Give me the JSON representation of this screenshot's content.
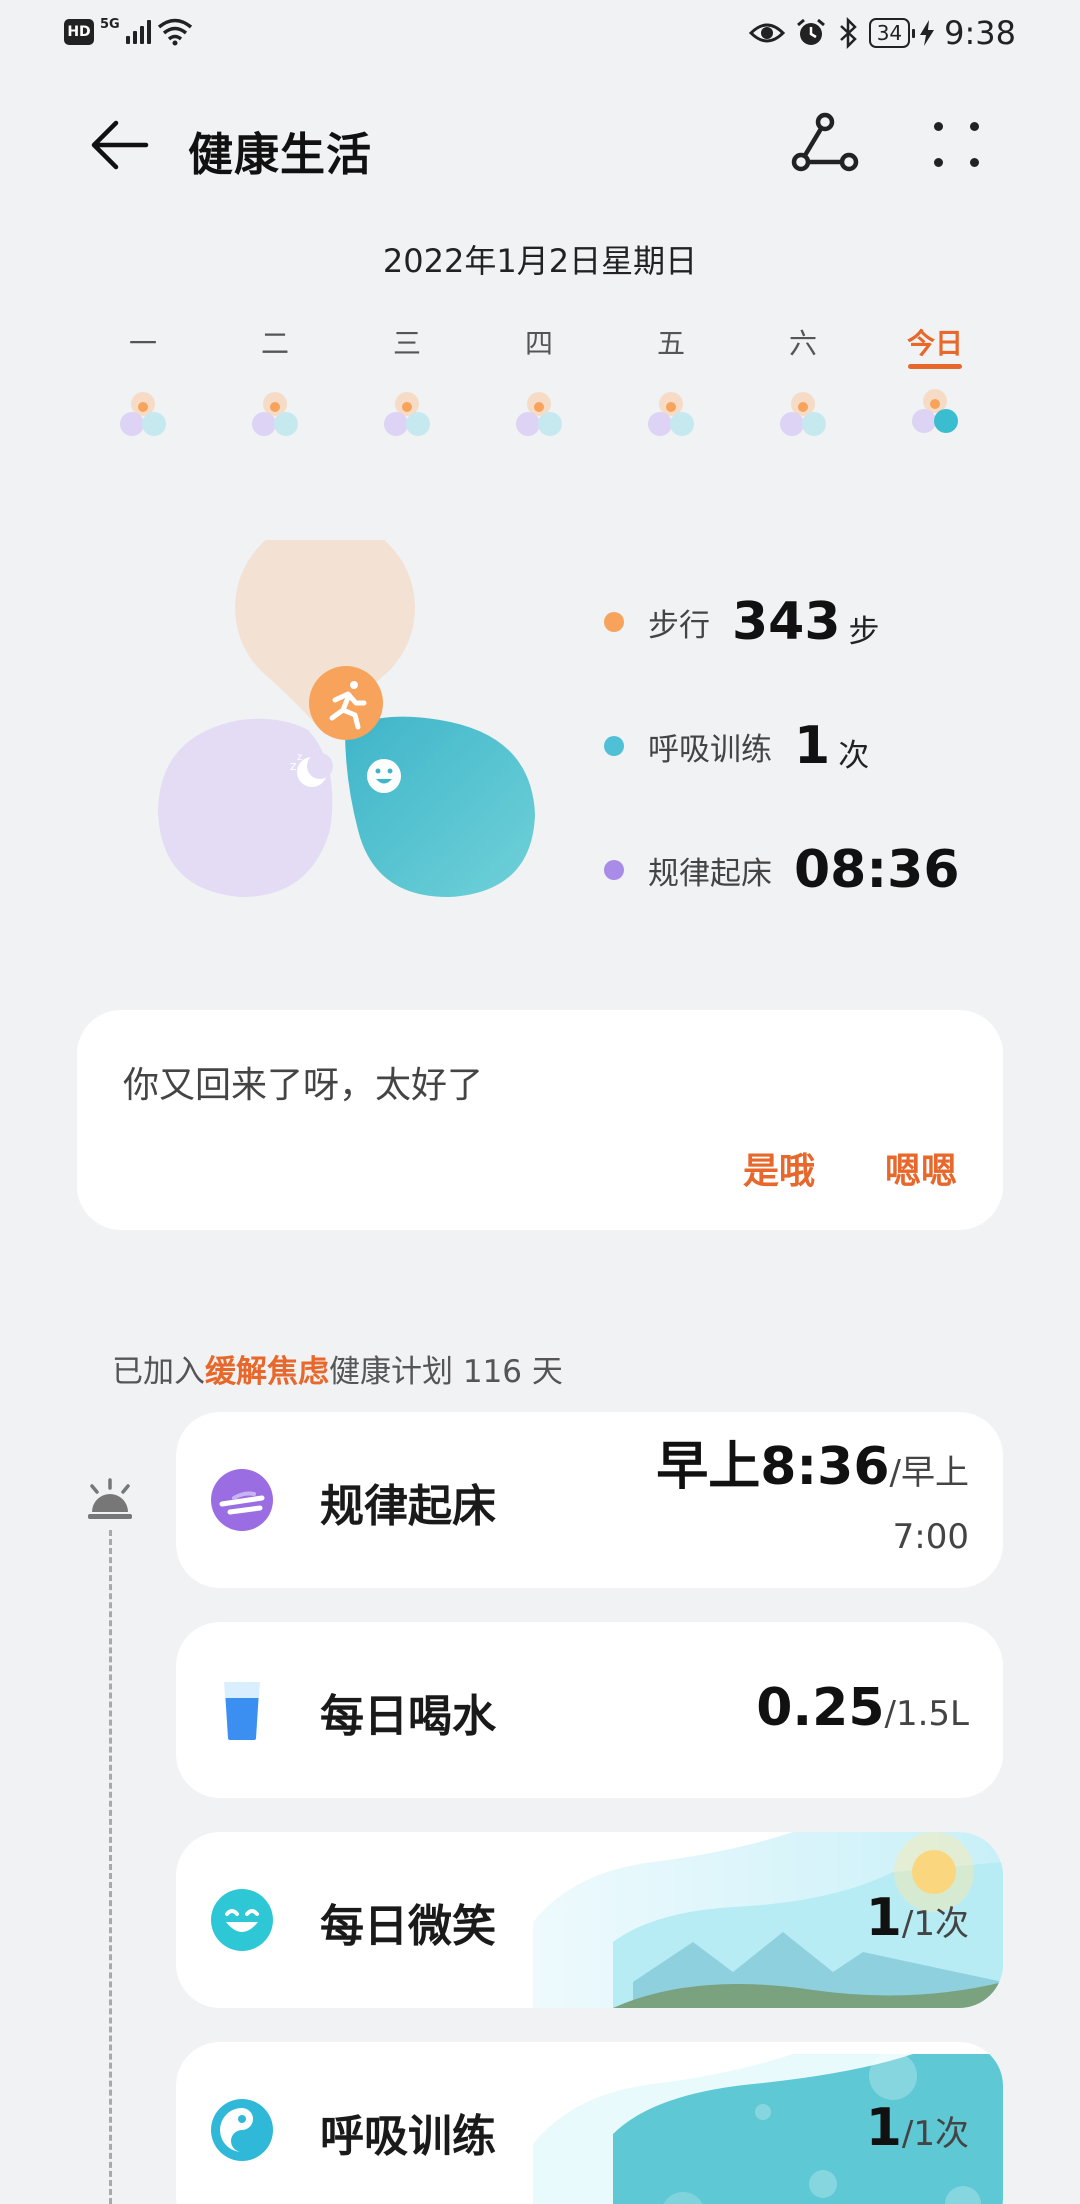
{
  "status_bar": {
    "hd": "HD",
    "network": "5G",
    "battery": "34",
    "time": "9:38"
  },
  "header": {
    "title": "健康生活"
  },
  "date": "2022年1月2日星期日",
  "week": [
    {
      "label": "一"
    },
    {
      "label": "二"
    },
    {
      "label": "三"
    },
    {
      "label": "四"
    },
    {
      "label": "五"
    },
    {
      "label": "六"
    },
    {
      "label": "今日",
      "today": true
    }
  ],
  "stats": [
    {
      "name": "步行",
      "value": "343",
      "unit": "步",
      "color": "#f7a35c"
    },
    {
      "name": "呼吸训练",
      "value": "1",
      "unit": "次",
      "color": "#4fc0d6"
    },
    {
      "name": "规律起床",
      "value": "08:36",
      "unit": "",
      "color": "#a98be8"
    }
  ],
  "message": {
    "text": "你又回来了呀，太好了",
    "button_yes": "是哦",
    "button_ok": "嗯嗯"
  },
  "plan": {
    "prefix": "已加入",
    "highlight": "缓解焦虑",
    "suffix": "健康计划 116 天"
  },
  "tasks": [
    {
      "name": "规律起床",
      "value": "早上8:36",
      "target_line1": "/早上",
      "target_line2": "7:00",
      "icon": "wake-up-icon"
    },
    {
      "name": "每日喝水",
      "value": "0.25",
      "target": "/1.5L",
      "icon": "water-cup-icon"
    },
    {
      "name": "每日微笑",
      "value": "1",
      "target": "/1次",
      "icon": "smile-icon"
    },
    {
      "name": "呼吸训练",
      "value": "1",
      "target": "/1次",
      "icon": "breathing-icon"
    }
  ],
  "colors": {
    "accent": "#e8672b",
    "walk": "#f7a35c",
    "breath": "#4fc0d6",
    "wake": "#a98be8"
  }
}
